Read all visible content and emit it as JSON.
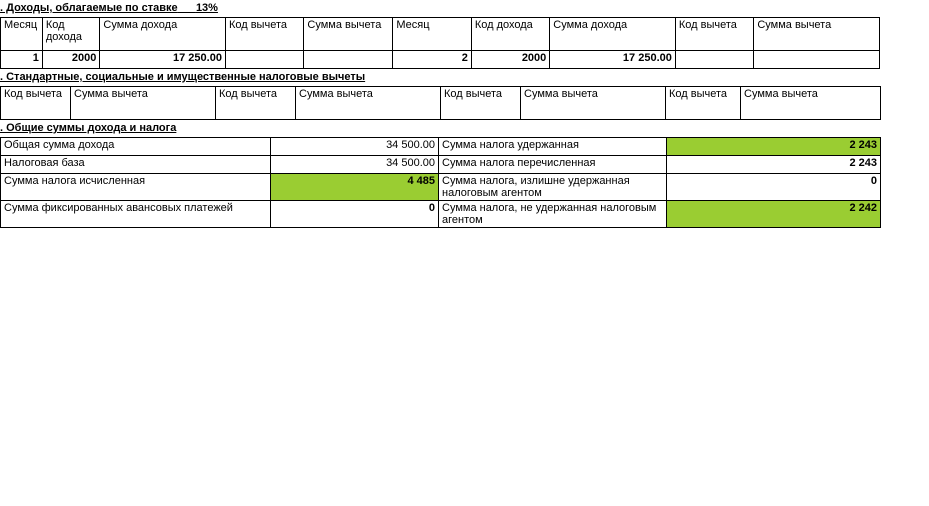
{
  "section3": {
    "title_prefix": ". Доходы, облагаемые по ставке",
    "rate": "13%",
    "headers": {
      "month": "Месяц",
      "income_code": "Код дохода",
      "income_sum": "Сумма дохода",
      "deduct_code": "Код вычета",
      "deduct_sum": "Сумма вычета"
    },
    "left": {
      "month": "1",
      "income_code": "2000",
      "income_sum": "17 250.00",
      "deduct_code": "",
      "deduct_sum": ""
    },
    "right": {
      "month": "2",
      "income_code": "2000",
      "income_sum": "17 250.00",
      "deduct_code": "",
      "deduct_sum": ""
    }
  },
  "section4": {
    "title": ". Стандартные, социальные и имущественные налоговые вычеты",
    "headers": {
      "code": "Код вычета",
      "sum": "Сумма вычета"
    }
  },
  "section5": {
    "title": ". Общие суммы дохода и налога",
    "rows": {
      "income_total_label": "Общая сумма дохода",
      "income_total_value": "34 500.00",
      "tax_base_label": "Налоговая база",
      "tax_base_value": "34 500.00",
      "tax_calc_label": "Сумма налога исчисленная",
      "tax_calc_value": "4 485",
      "fixed_adv_label": "Сумма фиксированных авансовых платежей",
      "fixed_adv_value": "0",
      "tax_withheld_label": "Сумма налога удержанная",
      "tax_withheld_value": "2 243",
      "tax_transferred_label": "Сумма налога перечисленная",
      "tax_transferred_value": "2 243",
      "tax_over_label": "Сумма налога, излишне удержанная налоговым агентом",
      "tax_over_value": "0",
      "tax_not_label": "Сумма налога, не удержанная налоговым агентом",
      "tax_not_value": "2 242"
    }
  }
}
